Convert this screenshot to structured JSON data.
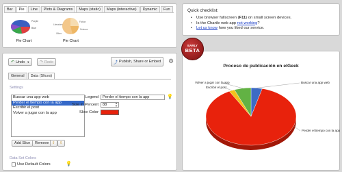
{
  "chart_type_tabs": [
    "Bar",
    "Pie",
    "Line",
    "Plots & Diagrams",
    "Maps (static)",
    "Maps (interactive)",
    "Dynamic",
    "Fun"
  ],
  "active_chart_tab": "Pie",
  "thumbnails": [
    {
      "caption": "Pie Chart",
      "labels": [
        "Purple",
        "Blue"
      ]
    },
    {
      "caption": "Pie Chart",
      "labels": [
        "Fiction",
        "Science",
        "Literature",
        "Other"
      ]
    }
  ],
  "checklist": {
    "title": "Quick checklist:",
    "items": [
      {
        "pre": "Use browser fullscreen (",
        "bold": "F11",
        "post": ") on small screen devices.",
        "link": ""
      },
      {
        "pre": "Is the Chartle web app ",
        "bold": "",
        "post": "?",
        "link": "not working"
      },
      {
        "pre": "",
        "bold": "",
        "post": " how you liked our service.",
        "link": "Let us know"
      }
    ]
  },
  "toolbar": {
    "undo": "Undo",
    "redo": "Redo",
    "publish": "Publish, Share or Embed"
  },
  "editor_tabs": [
    "General",
    "Data (Slices)"
  ],
  "active_editor_tab": "Data (Slices)",
  "settings_label": "Settings",
  "slices": [
    "Buscar una app web",
    "Perder el tiempo con la app",
    "Escribir el post",
    "Volver a jugar con la app"
  ],
  "selected_slice": "Perder el tiempo con la app",
  "legend_label": "Legend",
  "legend_value": "Perder el tiempo con la app",
  "size_label": "Size in Percent",
  "size_value": "88",
  "color_label": "Slice Color",
  "slice_color": "#e8220c",
  "add_slice": "Add Slice",
  "remove": "Remove",
  "data_colors_label": "Data Set Colors",
  "default_colors_label": "Use Default Colors",
  "beta_badge": {
    "top": "EARLY",
    "main": "BETA"
  },
  "chart_data": {
    "type": "pie",
    "title": "Proceso de publicación en elGeek",
    "categories": [
      "Buscar una app web",
      "Perder el tiempo con la app",
      "Escribir el post",
      "Volver a jugar con la app"
    ],
    "values": [
      4,
      88,
      2,
      6
    ],
    "colors": [
      "#3d6bc4",
      "#e8220c",
      "#f2c21c",
      "#62b244"
    ]
  }
}
